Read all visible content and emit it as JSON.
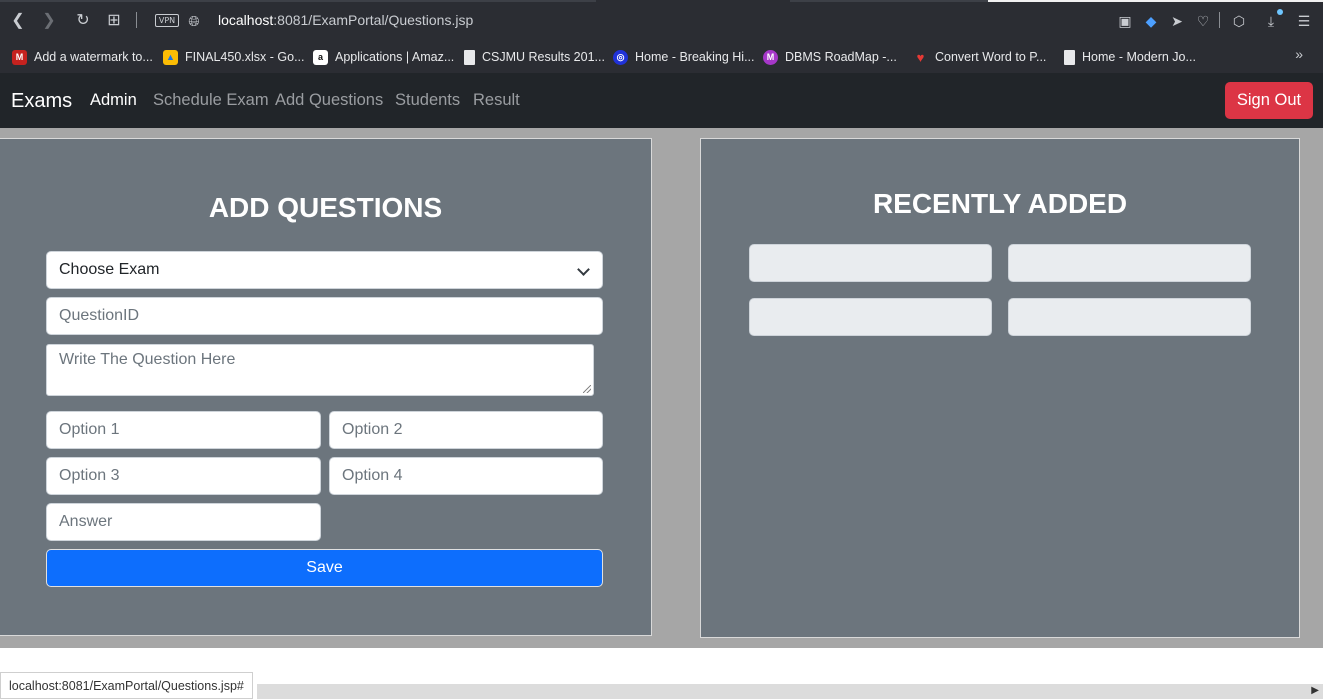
{
  "browser": {
    "url_host": "localhost",
    "url_path": ":8081/ExamPortal/Questions.jsp",
    "vpn_label": "VPN",
    "bookmarks": [
      {
        "label": "Add a watermark to...",
        "icon": "gmail-icon",
        "color": "#c5221f"
      },
      {
        "label": "FINAL450.xlsx - Go...",
        "icon": "drive-icon",
        "color": "#fbbc04"
      },
      {
        "label": "Applications | Amaz...",
        "icon": "amazon-icon",
        "color": "#ffffff"
      },
      {
        "label": "CSJMU Results 201...",
        "icon": "page-icon",
        "color": "#e8e9eb"
      },
      {
        "label": "Home - Breaking Hi...",
        "icon": "globe-icon",
        "color": "#2032d8"
      },
      {
        "label": "DBMS RoadMap -...",
        "icon": "m-icon",
        "color": "#a637c9"
      },
      {
        "label": "Convert Word to P...",
        "icon": "heart-icon",
        "color": "#e53935"
      },
      {
        "label": "Home - Modern Jo...",
        "icon": "page-icon",
        "color": "#e8e9eb"
      }
    ],
    "status_url": "localhost:8081/ExamPortal/Questions.jsp#"
  },
  "navbar": {
    "brand": "Exams",
    "links": [
      "Admin",
      "Schedule Exam",
      "Add Questions",
      "Students",
      "Result"
    ],
    "signout": "Sign Out"
  },
  "add_questions": {
    "title": "ADD QUESTIONS",
    "choose_exam": "Choose Exam",
    "question_id_placeholder": "QuestionID",
    "question_placeholder": "Write The Question Here",
    "option1_placeholder": "Option 1",
    "option2_placeholder": "Option 2",
    "option3_placeholder": "Option 3",
    "option4_placeholder": "Option 4",
    "answer_placeholder": "Answer",
    "save": "Save"
  },
  "recently_added": {
    "title": "RECENTLY ADDED"
  }
}
